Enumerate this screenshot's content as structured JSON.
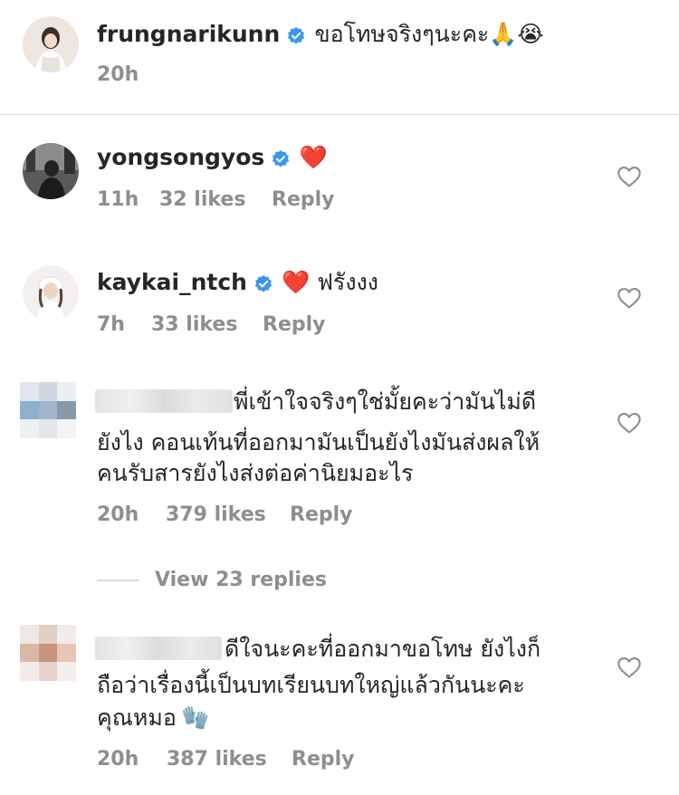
{
  "post": {
    "username": "frungnarikunn",
    "caption": "ขอโทษจริงๆนะคะ🙏😭",
    "time": "20h"
  },
  "comments": [
    {
      "username": "yongsongyos",
      "text": "❤️",
      "time": "11h",
      "likes": "32 likes",
      "reply": "Reply"
    },
    {
      "username": "kaykai_ntch",
      "text": "❤️ ฟรังงง",
      "time": "7h",
      "likes": "33 likes",
      "reply": "Reply"
    },
    {
      "line1": "พี่เข้าใจจริงๆใช่มั้ยคะว่ามันไม่ดี",
      "line2": "ยังไง คอนเท้นที่ออกมามันเป็นยังไงมันส่งผลให้",
      "line3": "คนรับสารยังไงส่งต่อค่านิยมอะไร",
      "time": "20h",
      "likes": "379 likes",
      "reply": "Reply",
      "view_replies": "View 23 replies"
    },
    {
      "line1": "ดีใจนะคะที่ออกมาขอโทษ ยังไงก็",
      "line2": "ถือว่าเรื่องนี้เป็นบทเรียนบทใหญ่แล้วกันนะคะ",
      "line3": "คุณหมอ",
      "emoji": "🧤",
      "time": "20h",
      "likes": "387 likes",
      "reply": "Reply"
    }
  ],
  "icons": {
    "verified": "verified-badge-icon",
    "like": "heart-outline-icon"
  },
  "colors": {
    "verified": "#3897f0",
    "meta": "#8e8e8e",
    "divider": "#dbdbdb",
    "heart": "#ed4956",
    "glove": "#4caf50"
  }
}
